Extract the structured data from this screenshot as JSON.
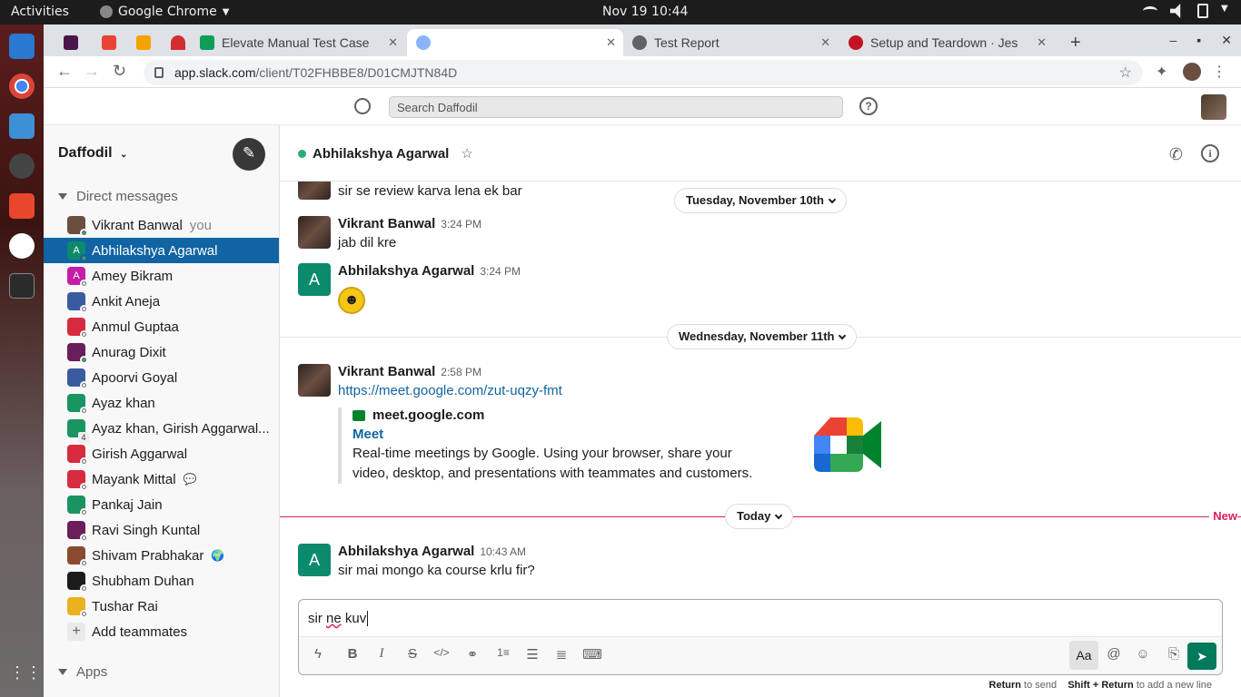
{
  "os": {
    "activities": "Activities",
    "app_name": "Google Chrome",
    "clock": "Nov 19  10:44"
  },
  "browser": {
    "tabs": [
      {
        "label": "Elevate Manual Test Case"
      },
      {
        "label": ""
      },
      {
        "label": "Test Report"
      },
      {
        "label": "Setup and Teardown · Jes"
      }
    ],
    "url_host": "app.slack.com",
    "url_path": "/client/T02FHBBE8/D01CMJTN84D"
  },
  "slack_top": {
    "search_placeholder": "Search Daffodil",
    "help": "?"
  },
  "sidebar": {
    "workspace": "Daffodil",
    "direct_messages_label": "Direct messages",
    "dms": [
      {
        "name": "Vikrant Banwal",
        "suffix": "you",
        "color": "#6a4e40",
        "status": "#2bac76"
      },
      {
        "name": "Abhilakshya Agarwal",
        "initial": "A",
        "color": "#0b8a6c",
        "status": "#2bac76"
      },
      {
        "name": "Amey Bikram",
        "initial": "A",
        "color": "#c41ea8",
        "status": "#f8f8f8"
      },
      {
        "name": "Ankit Aneja",
        "color": "#3a5ba0",
        "status": "#f8f8f8"
      },
      {
        "name": "Anmul Guptaa",
        "color": "#d72b3f",
        "status": "#f8f8f8"
      },
      {
        "name": "Anurag Dixit",
        "color": "#6a1e5a",
        "status": "#2bac76"
      },
      {
        "name": "Apoorvi Goyal",
        "color": "#3a5ba0",
        "status": "#f8f8f8"
      },
      {
        "name": "Ayaz khan",
        "color": "#1a9460",
        "status": "#f8f8f8"
      },
      {
        "name": "Ayaz khan, Girish Aggarwal...",
        "count": "4",
        "color": "#1a9460",
        "status": ""
      },
      {
        "name": "Girish Aggarwal",
        "color": "#d72b3f",
        "status": "#f8f8f8"
      },
      {
        "name": "Mayank Mittal",
        "extra": "💬",
        "color": "#d72b3f",
        "status": "#f8f8f8"
      },
      {
        "name": "Pankaj Jain",
        "color": "#1a9460",
        "status": "#f8f8f8"
      },
      {
        "name": "Ravi Singh Kuntal",
        "color": "#6a1e5a",
        "status": "#f8f8f8"
      },
      {
        "name": "Shivam Prabhakar",
        "extra": "🌍",
        "color": "#8a4a30",
        "status": "#f8f8f8"
      },
      {
        "name": "Shubham Duhan",
        "color": "#1d1c1d",
        "status": "#f8f8f8"
      },
      {
        "name": "Tushar Rai",
        "color": "#e8b220",
        "status": "#f8f8f8"
      }
    ],
    "add_teammates": "Add teammates",
    "apps_label": "Apps"
  },
  "channel": {
    "title": "Abhilakshya Agarwal"
  },
  "messages": {
    "top_text": "sir se review karva lena ek bar",
    "day1": "Tuesday, November 10th",
    "m1_author": "Vikrant Banwal",
    "m1_time": "3:24 PM",
    "m1_text": "jab dil kre",
    "m2_author": "Abhilakshya Agarwal",
    "m2_initial": "A",
    "m2_time": "3:24 PM",
    "day2": "Wednesday, November 11th",
    "m3_author": "Vikrant Banwal",
    "m3_time": "2:58 PM",
    "m3_link": "https://meet.google.com/zut-uqzy-fmt",
    "unfurl_site": "meet.google.com",
    "unfurl_title": "Meet",
    "unfurl_desc": "Real-time meetings by Google. Using your browser, share your video, desktop, and presentations with teammates and customers.",
    "day3": "Today",
    "new_label": "New",
    "m4_author": "Abhilakshya Agarwal",
    "m4_initial": "A",
    "m4_time": "10:43 AM",
    "m4_text": "sir mai mongo ka course krlu fir?"
  },
  "composer": {
    "text_a": "sir ",
    "text_b": "ne",
    "text_c": " kuv",
    "aa": "Aa",
    "hint_return": "Return",
    "hint_send": " to send",
    "hint_shift": "Shift + Return",
    "hint_newline": " to add a new line"
  }
}
